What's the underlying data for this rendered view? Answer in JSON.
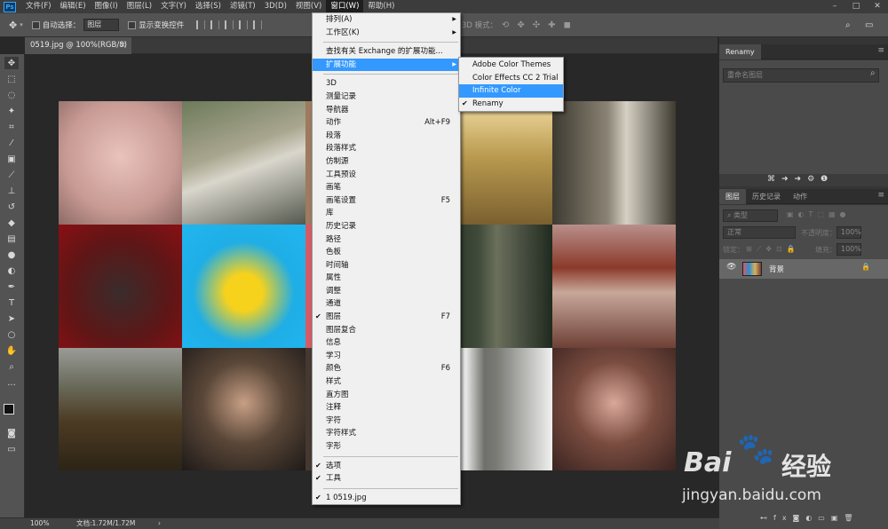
{
  "menubar": {
    "items": [
      "文件(F)",
      "编辑(E)",
      "图像(I)",
      "图层(L)",
      "文字(Y)",
      "选择(S)",
      "滤镜(T)",
      "3D(D)",
      "视图(V)",
      "窗口(W)",
      "帮助(H)"
    ],
    "active_index": 9
  },
  "options_bar": {
    "auto_select_label": "自动选择：",
    "auto_select_value": "图层",
    "transform_label": "显示变换控件",
    "mode_label": "3D 模式："
  },
  "document_tab": {
    "title": "0519.jpg @ 100%(RGB/8)",
    "close": "×"
  },
  "status_bar": {
    "zoom": "100%",
    "doc": "文档:1.72M/1.72M",
    "arrow": "›"
  },
  "renamy_panel": {
    "tab": "Renamy",
    "search_placeholder": "重命名图层"
  },
  "layers_panel": {
    "tabs": [
      "图层",
      "历史记录",
      "动作"
    ],
    "filter_label": "类型",
    "blend_mode": "正常",
    "opacity_label": "不透明度：",
    "opacity_value": "100%",
    "lock_label": "锁定：",
    "fill_label": "填充：",
    "fill_value": "100%",
    "layer_name": "背景"
  },
  "window_menu": {
    "group1": [
      {
        "label": "排列(A)",
        "arrow": "▶"
      },
      {
        "label": "工作区(K)",
        "arrow": "▶"
      }
    ],
    "group2": [
      {
        "label": "查找有关 Exchange 的扩展功能..."
      },
      {
        "label": "扩展功能",
        "arrow": "▶",
        "highlight": true
      }
    ],
    "group3": [
      {
        "label": "3D"
      },
      {
        "label": "测量记录"
      },
      {
        "label": "导航器"
      },
      {
        "label": "动作",
        "shortcut": "Alt+F9"
      },
      {
        "label": "段落"
      },
      {
        "label": "段落样式"
      },
      {
        "label": "仿制源"
      },
      {
        "label": "工具预设"
      },
      {
        "label": "画笔"
      },
      {
        "label": "画笔设置",
        "shortcut": "F5"
      },
      {
        "label": "库"
      },
      {
        "label": "历史记录"
      },
      {
        "label": "路径"
      },
      {
        "label": "色板"
      },
      {
        "label": "时间轴"
      },
      {
        "label": "属性"
      },
      {
        "label": "调整"
      },
      {
        "label": "通道"
      },
      {
        "label": "图层",
        "shortcut": "F7",
        "check": "✔"
      },
      {
        "label": "图层复合"
      },
      {
        "label": "信息"
      },
      {
        "label": "学习"
      },
      {
        "label": "颜色",
        "shortcut": "F6"
      },
      {
        "label": "样式"
      },
      {
        "label": "直方图"
      },
      {
        "label": "注释"
      },
      {
        "label": "字符"
      },
      {
        "label": "字符样式"
      },
      {
        "label": "字形"
      }
    ],
    "group4": [
      {
        "label": "选项",
        "check": "✔"
      },
      {
        "label": "工具",
        "check": "✔"
      }
    ],
    "group5": [
      {
        "label": "1 0519.jpg",
        "check": "✔"
      }
    ]
  },
  "extensions_submenu": [
    {
      "label": "Adobe Color Themes"
    },
    {
      "label": "Color Effects CC 2 Trial"
    },
    {
      "label": "Infinite Color",
      "highlight": true
    },
    {
      "label": "Renamy",
      "check": "✔"
    }
  ],
  "watermark": {
    "brand": "Bai",
    "brand2": "经验",
    "url": "jingyan.baidu.com"
  },
  "colors": {
    "highlight": "#3399ff",
    "menu_bg": "#f0f0f0",
    "app_bg": "#282828",
    "panel_bg": "#535353"
  }
}
